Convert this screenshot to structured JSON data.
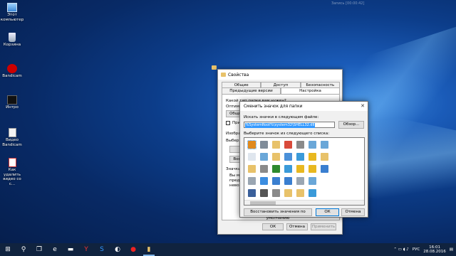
{
  "desktop": {
    "icons": [
      {
        "label": "Этот компьютер",
        "icon": "computer-icon"
      },
      {
        "label": "Корзина",
        "icon": "recycle-bin-icon"
      },
      {
        "label": "Bandicam",
        "icon": "bandicam-icon"
      },
      {
        "label": "Интро",
        "icon": "video-file-icon"
      },
      {
        "label": "Видео Bandicam",
        "icon": "document-icon"
      },
      {
        "label": "Как удалить видео со с...",
        "icon": "pdf-icon"
      }
    ],
    "recorder_overlay": "Запись [00:00:42]"
  },
  "properties_dialog": {
    "title": "Свойства",
    "tabs_row1": [
      "Общие",
      "Доступ",
      "Безопасность"
    ],
    "tabs_row2": [
      "Предыдущие версии",
      "Настройка"
    ],
    "active_tab": "Настройка",
    "partial_labels": [
      "Какой тип папки вам нужен?",
      "Оптими",
      "Общие",
      "При",
      "Изобра",
      "Выбер",
      "Восс",
      "Значки",
      "Вы мо",
      "предст",
      "невозм"
    ],
    "buttons": {
      "ok": "ОК",
      "cancel": "Отмена",
      "apply": "Применить"
    }
  },
  "change_icon_dialog": {
    "title": "Сменить значок для папки",
    "search_label": "Искать значки в следующем файле:",
    "path_value": "%SystemRoot%\\system32\\SHELL32.dll",
    "browse_button": "Обзор...",
    "list_label": "Выберите значок из следующего списка:",
    "restore_button": "Восстановить значения по умолчанию",
    "ok_button": "ОК",
    "cancel_button": "Отмена",
    "icons": [
      {
        "name": "arrow-shortcut-icon",
        "color": "#e08a1e"
      },
      {
        "name": "document-icon",
        "color": "#dfe6ee"
      },
      {
        "name": "folder-icon",
        "color": "#e8c26a"
      },
      {
        "name": "cd-drive-icon",
        "color": "#9aa6b2"
      },
      {
        "name": "floppy-icon",
        "color": "#3a5f9a"
      },
      {
        "name": "network-drive-icon",
        "color": "#7f8c99"
      },
      {
        "name": "search-icon",
        "color": "#6aa7d8"
      },
      {
        "name": "printer-icon",
        "color": "#8a8a8a"
      },
      {
        "name": "help-icon",
        "color": "#3b8de0"
      },
      {
        "name": "shortcut-small-icon",
        "color": "#555555"
      },
      {
        "name": "folder-picture-icon",
        "color": "#e8c26a"
      },
      {
        "name": "folder-open-icon",
        "color": "#e8c26a"
      },
      {
        "name": "tree-icon",
        "color": "#2e8a2e"
      },
      {
        "name": "window-icon",
        "color": "#3a7fd0"
      },
      {
        "name": "gear-icon",
        "color": "#8a8a8a"
      },
      {
        "name": "shield-icon",
        "color": "#d94a3a"
      },
      {
        "name": "computer-icon",
        "color": "#4a90d9"
      },
      {
        "name": "globe-icon",
        "color": "#3a9ad9"
      },
      {
        "name": "monitor-icon",
        "color": "#3a7fd0"
      },
      {
        "name": "folder-user-icon",
        "color": "#e8c26a"
      },
      {
        "name": "cabinet-icon",
        "color": "#8a8a8a"
      },
      {
        "name": "chart-icon",
        "color": "#3a9ad9"
      },
      {
        "name": "warning-icon",
        "color": "#e8b820"
      },
      {
        "name": "drive-icon",
        "color": "#9aa6b2"
      },
      {
        "name": "folder-doc-icon",
        "color": "#e8c26a"
      },
      {
        "name": "bat-icon",
        "color": "#6aa7d8"
      },
      {
        "name": "star-icon",
        "color": "#e8b820"
      },
      {
        "name": "lock-icon",
        "color": "#e8b820"
      },
      {
        "name": "disk-icon",
        "color": "#6aa7d8"
      },
      {
        "name": "transfer-icon",
        "color": "#3a9ad9"
      },
      {
        "name": "search-doc-icon",
        "color": "#6aa7d8"
      },
      {
        "name": "folder-shared-icon",
        "color": "#e8c26a"
      },
      {
        "name": "disk-blue-icon",
        "color": "#3a7fd0"
      }
    ]
  },
  "taskbar": {
    "items": [
      {
        "name": "start-icon",
        "glyph": "⊞"
      },
      {
        "name": "search-icon",
        "glyph": "⚲"
      },
      {
        "name": "task-view-icon",
        "glyph": "❐"
      },
      {
        "name": "edge-icon",
        "glyph": "e"
      },
      {
        "name": "explorer-icon",
        "glyph": "▬"
      },
      {
        "name": "yandex-icon",
        "glyph": "Y"
      },
      {
        "name": "skype-icon",
        "glyph": "S"
      },
      {
        "name": "media-icon",
        "glyph": "◐"
      },
      {
        "name": "bandicam-icon",
        "glyph": "●"
      },
      {
        "name": "folder-icon",
        "glyph": "▮"
      }
    ],
    "language": "РУС",
    "time": "16:01",
    "date": "28.08.2016"
  }
}
